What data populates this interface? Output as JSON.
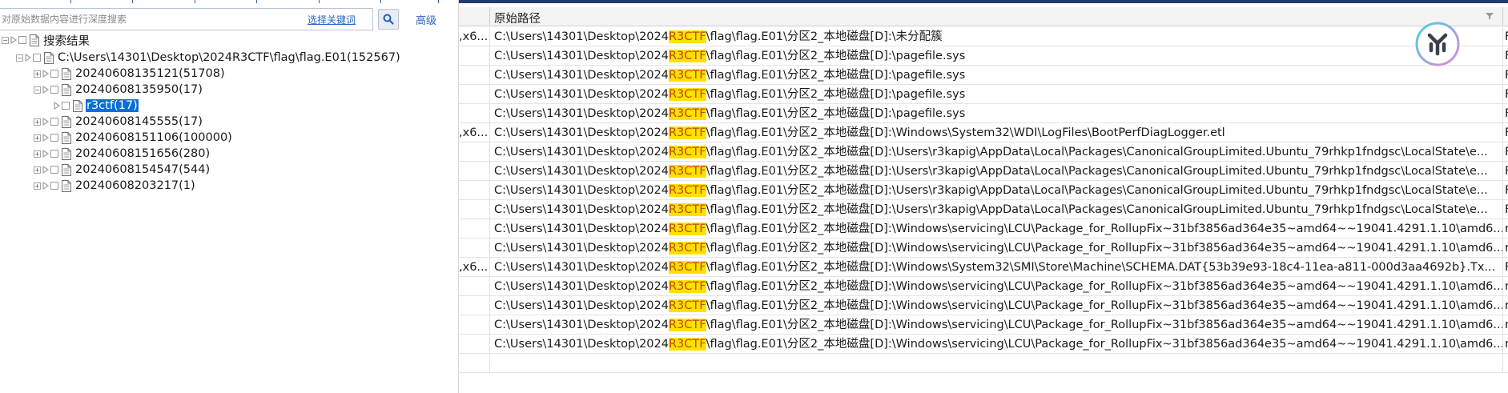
{
  "search": {
    "placeholder": "对原始数据内容进行深度搜索",
    "keyword_link": "选择关键词",
    "advanced_link": "高级"
  },
  "tree": {
    "root_label": "搜索结果",
    "evidence_label": "C:\\Users\\14301\\Desktop\\2024R3CTF\\flag\\flag.E01(152567)",
    "children": [
      {
        "label": "20240608135121(51708)",
        "expanded": false
      },
      {
        "label": "20240608135950(17)",
        "expanded": true
      },
      {
        "label": "r3ctf(17)",
        "selected": true
      },
      {
        "label": "20240608145555(17)",
        "expanded": false
      },
      {
        "label": "20240608151106(100000)",
        "expanded": false
      },
      {
        "label": "20240608151656(280)",
        "expanded": false
      },
      {
        "label": "20240608154547(544)",
        "expanded": false
      },
      {
        "label": "20240608203217(1)",
        "expanded": false
      }
    ]
  },
  "table": {
    "header": "原始路径",
    "highlight_term": "R3CTF",
    "rows": [
      {
        "c0": ",x6...",
        "pre": "C:\\Users\\14301\\Desktop\\2024",
        "hit": "R3CTF",
        "post": "\\flag\\flag.E01\\分区2_本地磁盘[D]:\\未分配簇",
        "c2": "F"
      },
      {
        "c0": "",
        "pre": "C:\\Users\\14301\\Desktop\\2024",
        "hit": "R3CTF",
        "post": "\\flag\\flag.E01\\分区2_本地磁盘[D]:\\pagefile.sys",
        "c2": "F"
      },
      {
        "c0": "",
        "pre": "C:\\Users\\14301\\Desktop\\2024",
        "hit": "R3CTF",
        "post": "\\flag\\flag.E01\\分区2_本地磁盘[D]:\\pagefile.sys",
        "c2": "F"
      },
      {
        "c0": "",
        "pre": "C:\\Users\\14301\\Desktop\\2024",
        "hit": "R3CTF",
        "post": "\\flag\\flag.E01\\分区2_本地磁盘[D]:\\pagefile.sys",
        "c2": "F"
      },
      {
        "c0": "",
        "pre": "C:\\Users\\14301\\Desktop\\2024",
        "hit": "R3CTF",
        "post": "\\flag\\flag.E01\\分区2_本地磁盘[D]:\\pagefile.sys",
        "c2": "F"
      },
      {
        "c0": ",x6...",
        "pre": "C:\\Users\\14301\\Desktop\\2024",
        "hit": "R3CTF",
        "post": "\\flag\\flag.E01\\分区2_本地磁盘[D]:\\Windows\\System32\\WDI\\LogFiles\\BootPerfDiagLogger.etl",
        "c2": "F"
      },
      {
        "c0": "",
        "pre": "C:\\Users\\14301\\Desktop\\2024",
        "hit": "R3CTF",
        "post": "\\flag\\flag.E01\\分区2_本地磁盘[D]:\\Users\\r3kapig\\AppData\\Local\\Packages\\CanonicalGroupLimited.Ubuntu_79rhkp1fndgsc\\LocalState\\e...",
        "c2": "F"
      },
      {
        "c0": "",
        "pre": "C:\\Users\\14301\\Desktop\\2024",
        "hit": "R3CTF",
        "post": "\\flag\\flag.E01\\分区2_本地磁盘[D]:\\Users\\r3kapig\\AppData\\Local\\Packages\\CanonicalGroupLimited.Ubuntu_79rhkp1fndgsc\\LocalState\\e...",
        "c2": "F"
      },
      {
        "c0": "",
        "pre": "C:\\Users\\14301\\Desktop\\2024",
        "hit": "R3CTF",
        "post": "\\flag\\flag.E01\\分区2_本地磁盘[D]:\\Users\\r3kapig\\AppData\\Local\\Packages\\CanonicalGroupLimited.Ubuntu_79rhkp1fndgsc\\LocalState\\e...",
        "c2": "F"
      },
      {
        "c0": "",
        "pre": "C:\\Users\\14301\\Desktop\\2024",
        "hit": "R3CTF",
        "post": "\\flag\\flag.E01\\分区2_本地磁盘[D]:\\Users\\r3kapig\\AppData\\Local\\Packages\\CanonicalGroupLimited.Ubuntu_79rhkp1fndgsc\\LocalState\\e...",
        "c2": "F"
      },
      {
        "c0": "",
        "pre": "C:\\Users\\14301\\Desktop\\2024",
        "hit": "R3CTF",
        "post": "\\flag\\flag.E01\\分区2_本地磁盘[D]:\\Windows\\servicing\\LCU\\Package_for_RollupFix~31bf3856ad364e35~amd64~~19041.4291.1.10\\amd6...",
        "c2": "r"
      },
      {
        "c0": "",
        "pre": "C:\\Users\\14301\\Desktop\\2024",
        "hit": "R3CTF",
        "post": "\\flag\\flag.E01\\分区2_本地磁盘[D]:\\Windows\\servicing\\LCU\\Package_for_RollupFix~31bf3856ad364e35~amd64~~19041.4291.1.10\\amd6...",
        "c2": "r"
      },
      {
        "c0": ",x6...",
        "pre": "C:\\Users\\14301\\Desktop\\2024",
        "hit": "R3CTF",
        "post": "\\flag\\flag.E01\\分区2_本地磁盘[D]:\\Windows\\System32\\SMI\\Store\\Machine\\SCHEMA.DAT{53b39e93-18c4-11ea-a811-000d3aa4692b}.Tx...",
        "c2": "F"
      },
      {
        "c0": "",
        "pre": "C:\\Users\\14301\\Desktop\\2024",
        "hit": "R3CTF",
        "post": "\\flag\\flag.E01\\分区2_本地磁盘[D]:\\Windows\\servicing\\LCU\\Package_for_RollupFix~31bf3856ad364e35~amd64~~19041.4291.1.10\\amd6...",
        "c2": "r"
      },
      {
        "c0": "",
        "pre": "C:\\Users\\14301\\Desktop\\2024",
        "hit": "R3CTF",
        "post": "\\flag\\flag.E01\\分区2_本地磁盘[D]:\\Windows\\servicing\\LCU\\Package_for_RollupFix~31bf3856ad364e35~amd64~~19041.4291.1.10\\amd6...",
        "c2": "r"
      },
      {
        "c0": "",
        "pre": "C:\\Users\\14301\\Desktop\\2024",
        "hit": "R3CTF",
        "post": "\\flag\\flag.E01\\分区2_本地磁盘[D]:\\Windows\\servicing\\LCU\\Package_for_RollupFix~31bf3856ad364e35~amd64~~19041.4291.1.10\\amd6...",
        "c2": "r"
      },
      {
        "c0": "",
        "pre": "C:\\Users\\14301\\Desktop\\2024",
        "hit": "R3CTF",
        "post": "\\flag\\flag.E01\\分区2_本地磁盘[D]:\\Windows\\servicing\\LCU\\Package_for_RollupFix~31bf3856ad364e35~amd64~~19041.4291.1.10\\amd6...",
        "c2": "r"
      },
      {
        "c0": "",
        "pre": "",
        "hit": "",
        "post": "",
        "c2": ""
      }
    ]
  },
  "colors": {
    "accent": "#0a6fd6",
    "highlight_bg": "#ffe100",
    "highlight_fg": "#c04a00",
    "link": "#2a66c5"
  },
  "icons": {
    "search": "search-icon",
    "filter": "filter-icon",
    "document": "document-icon",
    "logo": "app-logo-icon"
  }
}
